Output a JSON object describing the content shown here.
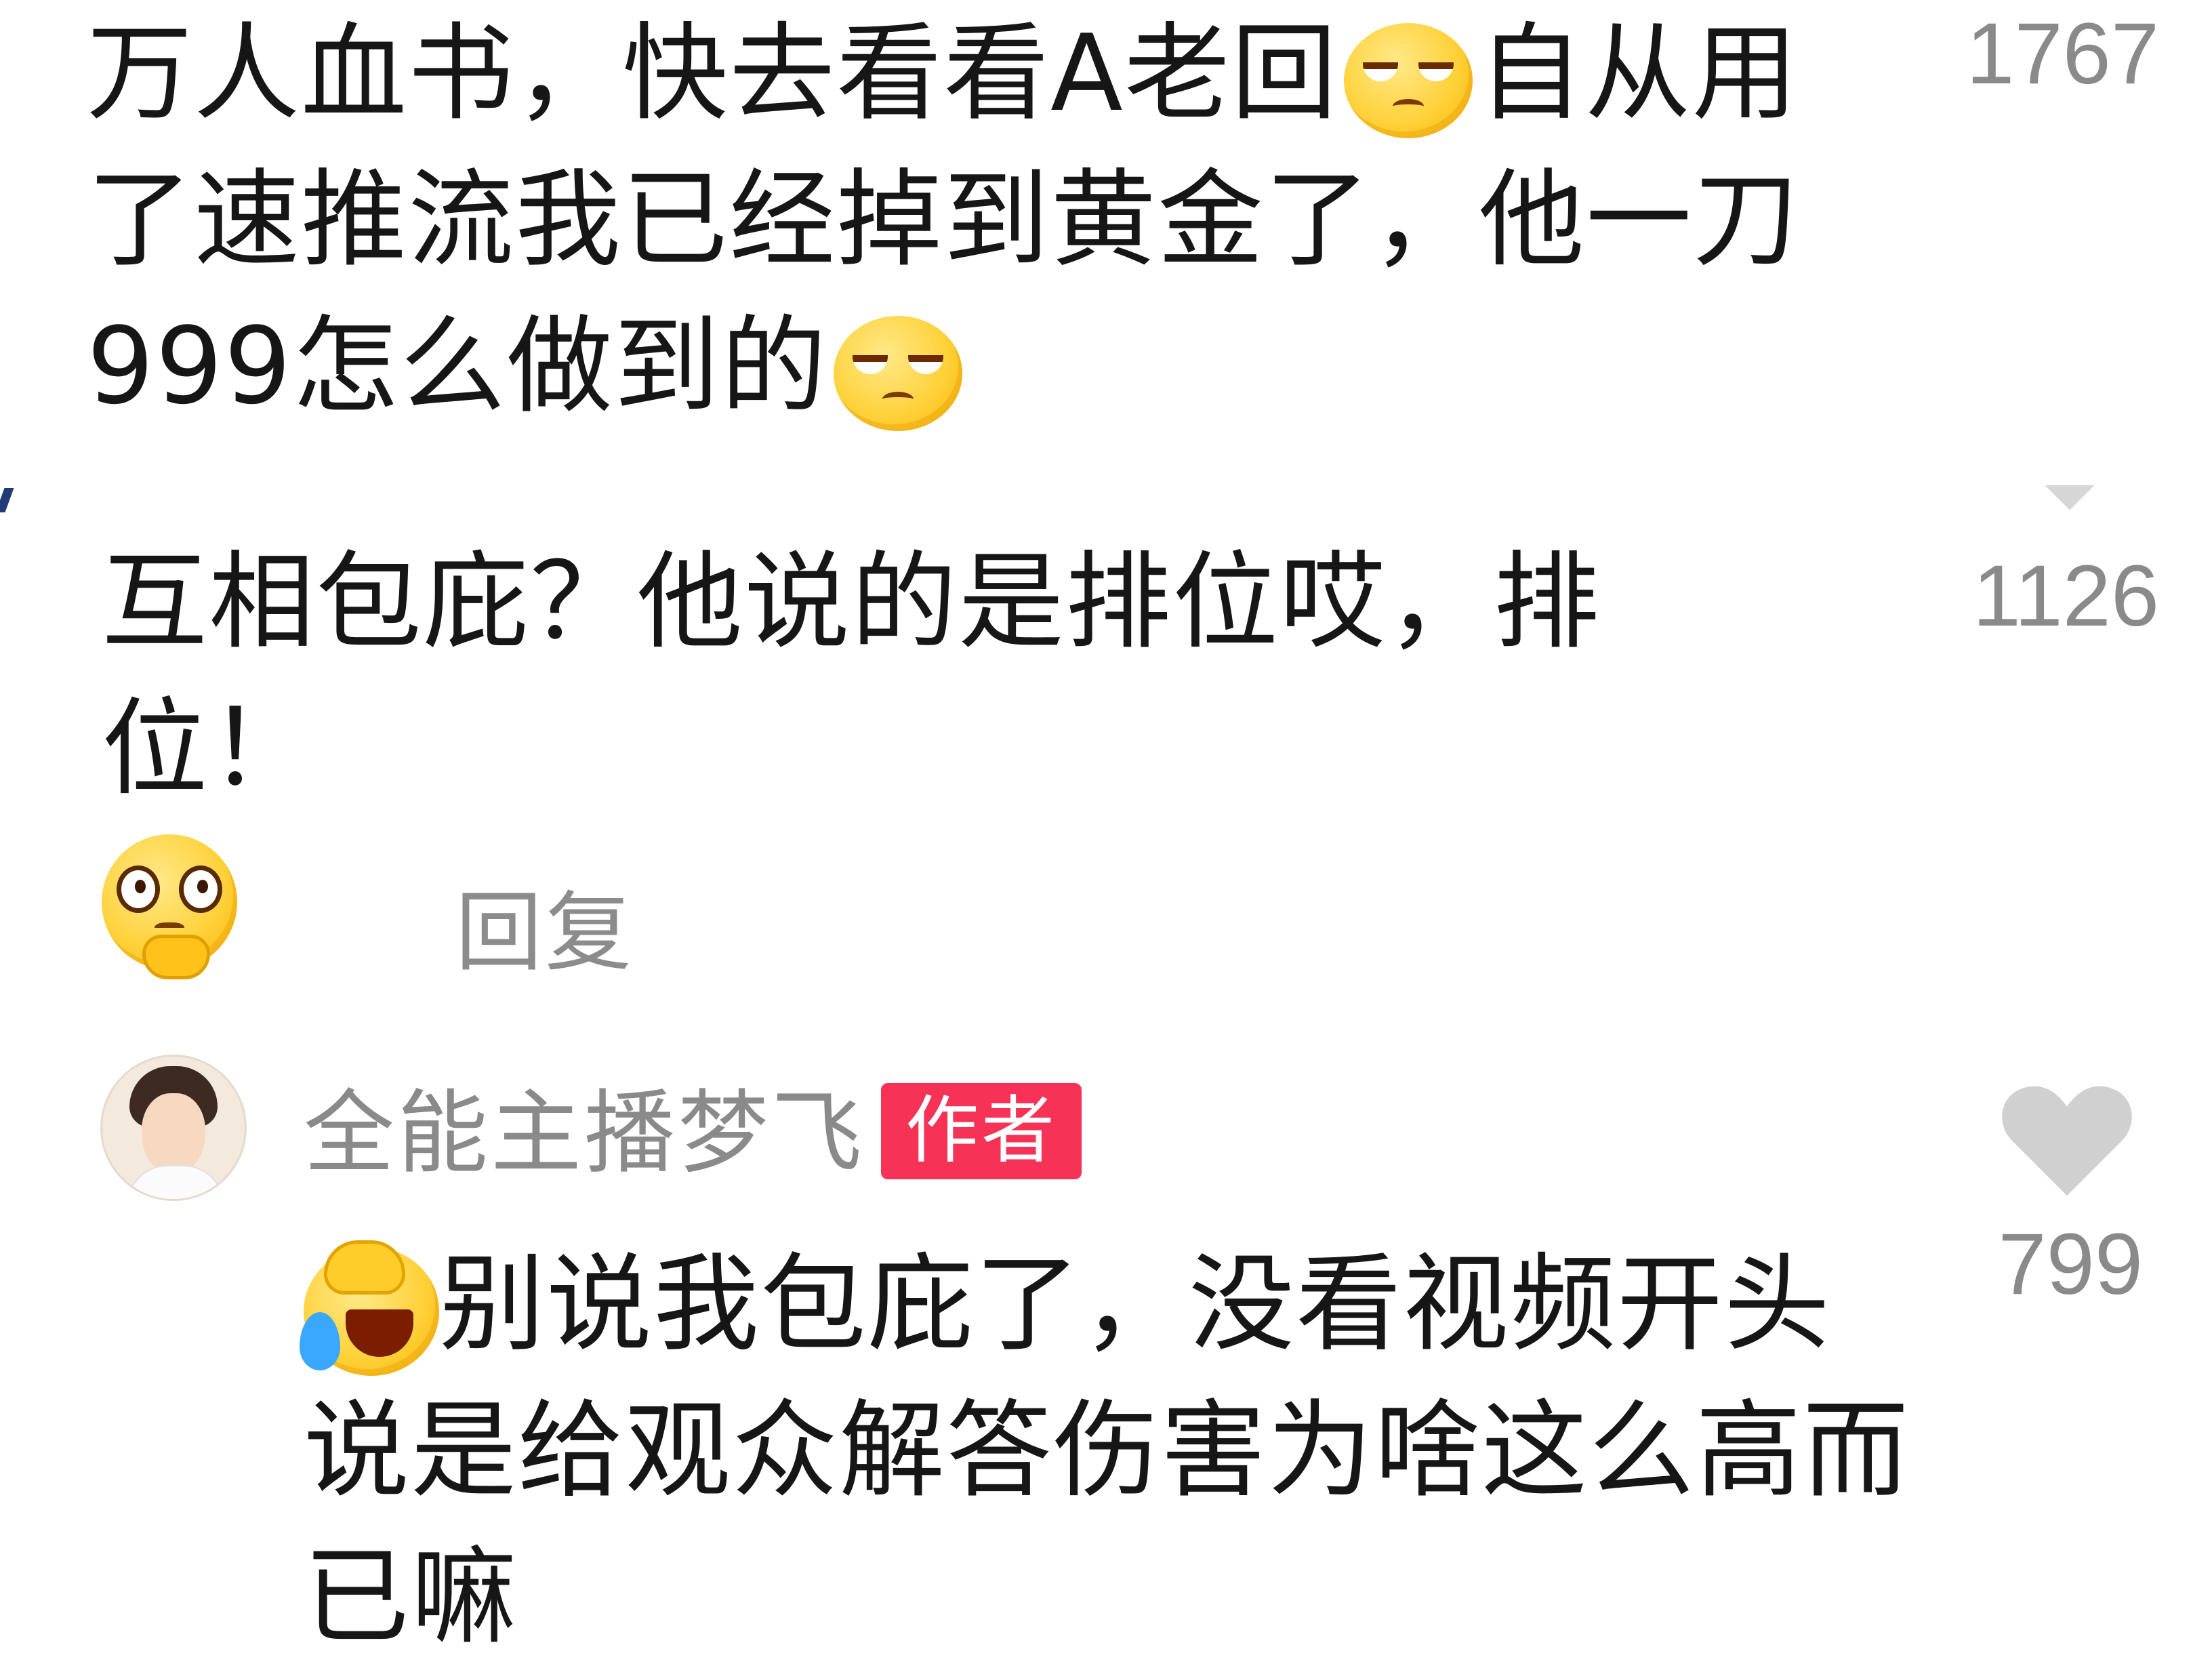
{
  "comments": [
    {
      "text_before_emoji_1": "万人血书，快去看看A老回",
      "text_between_emojis": "自从用了速推流我已经掉到黄金了，他一刀999怎么做到的",
      "emoji_1": "smirk-emoji",
      "emoji_2": "smirk-emoji",
      "likes": "1767"
    },
    {
      "text": "互相包庇？他说的是排位哎，排位！",
      "emoji": "thinking-emoji",
      "likes": "1126",
      "reply_label": "回复"
    },
    {
      "author_name": "全能主播梦飞",
      "author_badge": "作者",
      "emoji": "laughing-crying-emoji",
      "text": "别说我包庇了，没看视频开头说是给观众解答伤害为啥这么高而已嘛",
      "likes": "799"
    }
  ],
  "colors": {
    "badge_bg": "#f63257",
    "secondary_text": "#8a8a8a",
    "heart": "#d0d0d0"
  },
  "icons": [
    "heart-icon",
    "avatar"
  ]
}
